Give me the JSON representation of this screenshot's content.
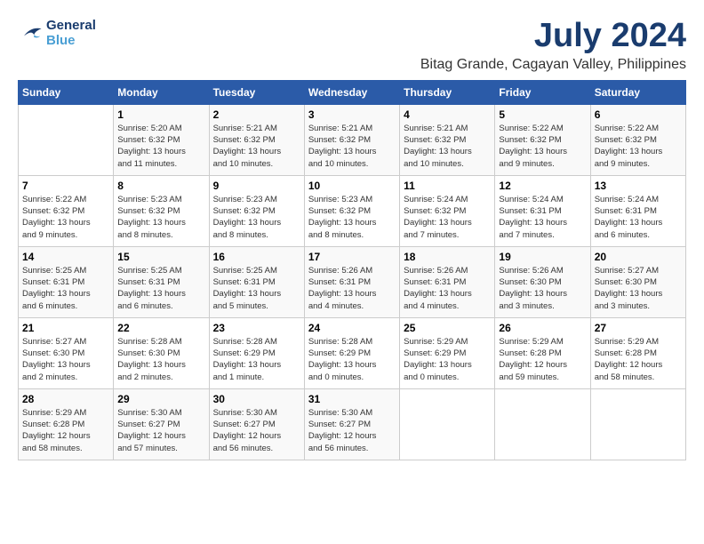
{
  "header": {
    "logo_line1": "General",
    "logo_line2": "Blue",
    "month": "July 2024",
    "location": "Bitag Grande, Cagayan Valley, Philippines"
  },
  "weekdays": [
    "Sunday",
    "Monday",
    "Tuesday",
    "Wednesday",
    "Thursday",
    "Friday",
    "Saturday"
  ],
  "weeks": [
    [
      {
        "day": "",
        "info": ""
      },
      {
        "day": "1",
        "info": "Sunrise: 5:20 AM\nSunset: 6:32 PM\nDaylight: 13 hours\nand 11 minutes."
      },
      {
        "day": "2",
        "info": "Sunrise: 5:21 AM\nSunset: 6:32 PM\nDaylight: 13 hours\nand 10 minutes."
      },
      {
        "day": "3",
        "info": "Sunrise: 5:21 AM\nSunset: 6:32 PM\nDaylight: 13 hours\nand 10 minutes."
      },
      {
        "day": "4",
        "info": "Sunrise: 5:21 AM\nSunset: 6:32 PM\nDaylight: 13 hours\nand 10 minutes."
      },
      {
        "day": "5",
        "info": "Sunrise: 5:22 AM\nSunset: 6:32 PM\nDaylight: 13 hours\nand 9 minutes."
      },
      {
        "day": "6",
        "info": "Sunrise: 5:22 AM\nSunset: 6:32 PM\nDaylight: 13 hours\nand 9 minutes."
      }
    ],
    [
      {
        "day": "7",
        "info": "Sunrise: 5:22 AM\nSunset: 6:32 PM\nDaylight: 13 hours\nand 9 minutes."
      },
      {
        "day": "8",
        "info": "Sunrise: 5:23 AM\nSunset: 6:32 PM\nDaylight: 13 hours\nand 8 minutes."
      },
      {
        "day": "9",
        "info": "Sunrise: 5:23 AM\nSunset: 6:32 PM\nDaylight: 13 hours\nand 8 minutes."
      },
      {
        "day": "10",
        "info": "Sunrise: 5:23 AM\nSunset: 6:32 PM\nDaylight: 13 hours\nand 8 minutes."
      },
      {
        "day": "11",
        "info": "Sunrise: 5:24 AM\nSunset: 6:32 PM\nDaylight: 13 hours\nand 7 minutes."
      },
      {
        "day": "12",
        "info": "Sunrise: 5:24 AM\nSunset: 6:31 PM\nDaylight: 13 hours\nand 7 minutes."
      },
      {
        "day": "13",
        "info": "Sunrise: 5:24 AM\nSunset: 6:31 PM\nDaylight: 13 hours\nand 6 minutes."
      }
    ],
    [
      {
        "day": "14",
        "info": "Sunrise: 5:25 AM\nSunset: 6:31 PM\nDaylight: 13 hours\nand 6 minutes."
      },
      {
        "day": "15",
        "info": "Sunrise: 5:25 AM\nSunset: 6:31 PM\nDaylight: 13 hours\nand 6 minutes."
      },
      {
        "day": "16",
        "info": "Sunrise: 5:25 AM\nSunset: 6:31 PM\nDaylight: 13 hours\nand 5 minutes."
      },
      {
        "day": "17",
        "info": "Sunrise: 5:26 AM\nSunset: 6:31 PM\nDaylight: 13 hours\nand 4 minutes."
      },
      {
        "day": "18",
        "info": "Sunrise: 5:26 AM\nSunset: 6:31 PM\nDaylight: 13 hours\nand 4 minutes."
      },
      {
        "day": "19",
        "info": "Sunrise: 5:26 AM\nSunset: 6:30 PM\nDaylight: 13 hours\nand 3 minutes."
      },
      {
        "day": "20",
        "info": "Sunrise: 5:27 AM\nSunset: 6:30 PM\nDaylight: 13 hours\nand 3 minutes."
      }
    ],
    [
      {
        "day": "21",
        "info": "Sunrise: 5:27 AM\nSunset: 6:30 PM\nDaylight: 13 hours\nand 2 minutes."
      },
      {
        "day": "22",
        "info": "Sunrise: 5:28 AM\nSunset: 6:30 PM\nDaylight: 13 hours\nand 2 minutes."
      },
      {
        "day": "23",
        "info": "Sunrise: 5:28 AM\nSunset: 6:29 PM\nDaylight: 13 hours\nand 1 minute."
      },
      {
        "day": "24",
        "info": "Sunrise: 5:28 AM\nSunset: 6:29 PM\nDaylight: 13 hours\nand 0 minutes."
      },
      {
        "day": "25",
        "info": "Sunrise: 5:29 AM\nSunset: 6:29 PM\nDaylight: 13 hours\nand 0 minutes."
      },
      {
        "day": "26",
        "info": "Sunrise: 5:29 AM\nSunset: 6:28 PM\nDaylight: 12 hours\nand 59 minutes."
      },
      {
        "day": "27",
        "info": "Sunrise: 5:29 AM\nSunset: 6:28 PM\nDaylight: 12 hours\nand 58 minutes."
      }
    ],
    [
      {
        "day": "28",
        "info": "Sunrise: 5:29 AM\nSunset: 6:28 PM\nDaylight: 12 hours\nand 58 minutes."
      },
      {
        "day": "29",
        "info": "Sunrise: 5:30 AM\nSunset: 6:27 PM\nDaylight: 12 hours\nand 57 minutes."
      },
      {
        "day": "30",
        "info": "Sunrise: 5:30 AM\nSunset: 6:27 PM\nDaylight: 12 hours\nand 56 minutes."
      },
      {
        "day": "31",
        "info": "Sunrise: 5:30 AM\nSunset: 6:27 PM\nDaylight: 12 hours\nand 56 minutes."
      },
      {
        "day": "",
        "info": ""
      },
      {
        "day": "",
        "info": ""
      },
      {
        "day": "",
        "info": ""
      }
    ]
  ]
}
